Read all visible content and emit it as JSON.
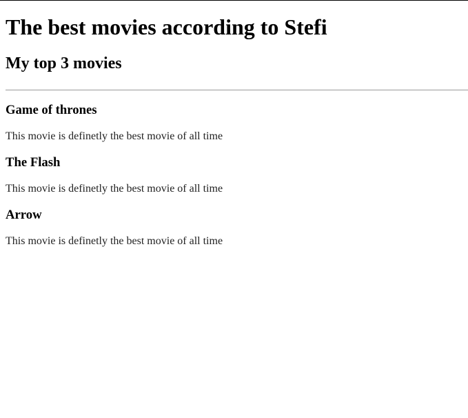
{
  "title": "The best movies according to Stefi",
  "subtitle": "My top 3 movies",
  "movies": [
    {
      "name": "Game of thrones",
      "description": "This movie is definetly the best movie of all time"
    },
    {
      "name": "The Flash",
      "description": "This movie is definetly the best movie of all time"
    },
    {
      "name": "Arrow",
      "description": "This movie is definetly the best movie of all time"
    }
  ]
}
